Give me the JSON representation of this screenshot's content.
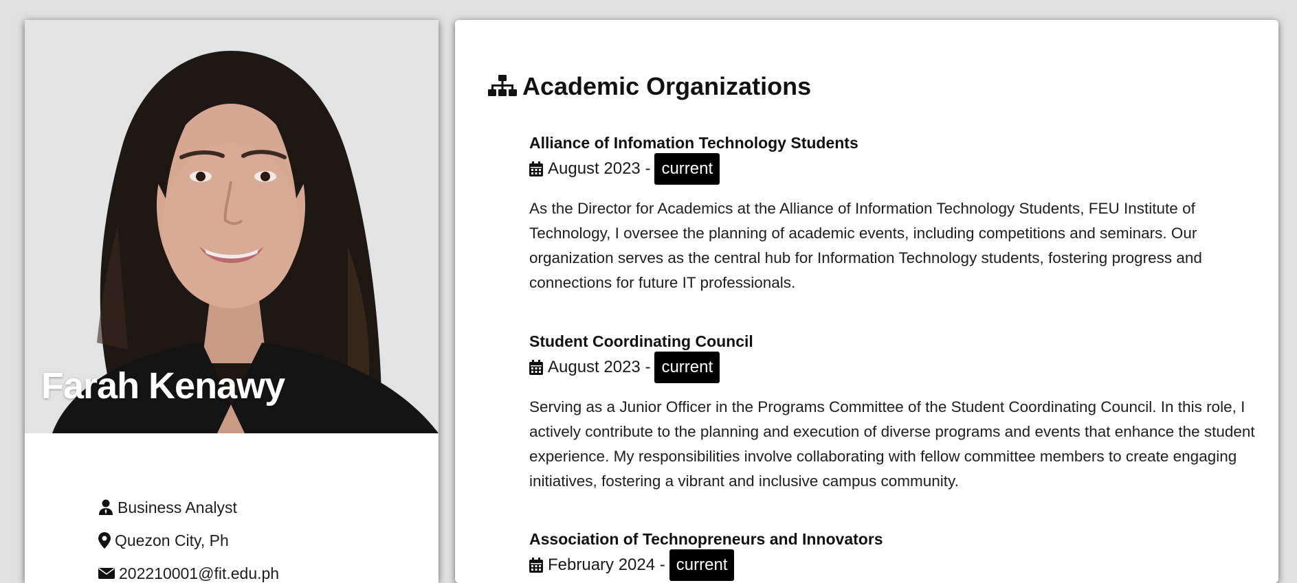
{
  "profile": {
    "name": "Farah Kenawy",
    "role": "Business Analyst",
    "location": "Quezon City, Ph",
    "email": "202210001@fit.edu.ph"
  },
  "section": {
    "title": "Academic Organizations",
    "icon": "sitemap-icon"
  },
  "organizations": [
    {
      "name": "Alliance of Infomation Technology Students",
      "start": "August 2023 -",
      "status": "current",
      "description": "As the Director for Academics at the Alliance of Information Technology Students, FEU Institute of Technology, I oversee the planning of academic events, including competitions and seminars. Our organization serves as the central hub for Information Technology students, fostering progress and connections for future IT professionals."
    },
    {
      "name": "Student Coordinating Council",
      "start": "August 2023 -",
      "status": "current",
      "description": "Serving as a Junior Officer in the Programs Committee of the Student Coordinating Council. In this role, I actively contribute to the planning and execution of diverse programs and events that enhance the student experience. My responsibilities involve collaborating with fellow committee members to create engaging initiatives, fostering a vibrant and inclusive campus community."
    },
    {
      "name": "Association of Technopreneurs and Innovators",
      "start": "February 2024 -",
      "status": "current",
      "description": ""
    }
  ],
  "colors": {
    "background": "#e1e1e1",
    "card": "#ffffff",
    "badge": "#000000",
    "photo_bg": "#e3e3e3"
  }
}
